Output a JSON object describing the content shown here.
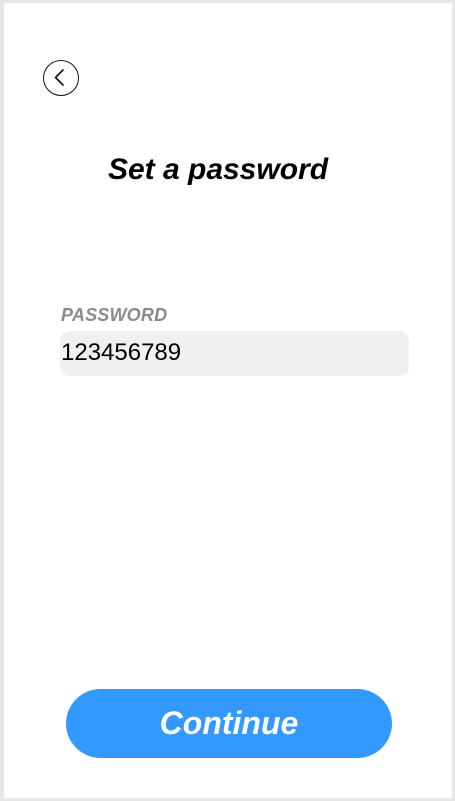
{
  "header": {
    "back_icon": "chevron-left-circle-icon"
  },
  "main": {
    "title": "Set a password",
    "password_field": {
      "label": "PASSWORD",
      "value": "123456789"
    }
  },
  "footer": {
    "continue_label": "Continue"
  },
  "colors": {
    "accent": "#3399ff",
    "input_background": "#f0f0f0",
    "label_gray": "#8a8a8a"
  }
}
